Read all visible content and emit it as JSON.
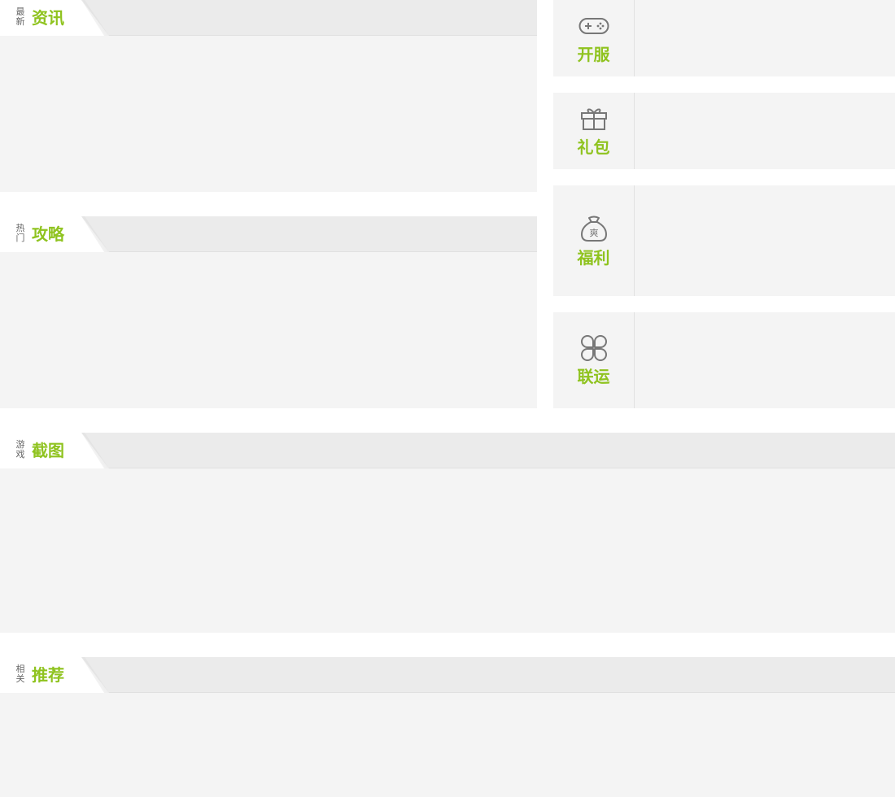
{
  "sections": {
    "news": {
      "small": "最新",
      "title": "资讯"
    },
    "guides": {
      "small": "热门",
      "title": "攻略"
    },
    "screenshots": {
      "small": "游戏",
      "title": "截图"
    },
    "recommend": {
      "small": "相关",
      "title": "推荐"
    }
  },
  "sidebar": {
    "items": [
      {
        "label": "开服",
        "icon": "gamepad-icon"
      },
      {
        "label": "礼包",
        "icon": "gift-icon"
      },
      {
        "label": "福利",
        "icon": "money-bag-icon",
        "icon_text": "爽"
      },
      {
        "label": "联运",
        "icon": "clover-icon"
      }
    ]
  },
  "colors": {
    "accent": "#8fc31f",
    "panel": "#f4f4f4",
    "header": "#ebebeb",
    "icon": "#777777"
  }
}
